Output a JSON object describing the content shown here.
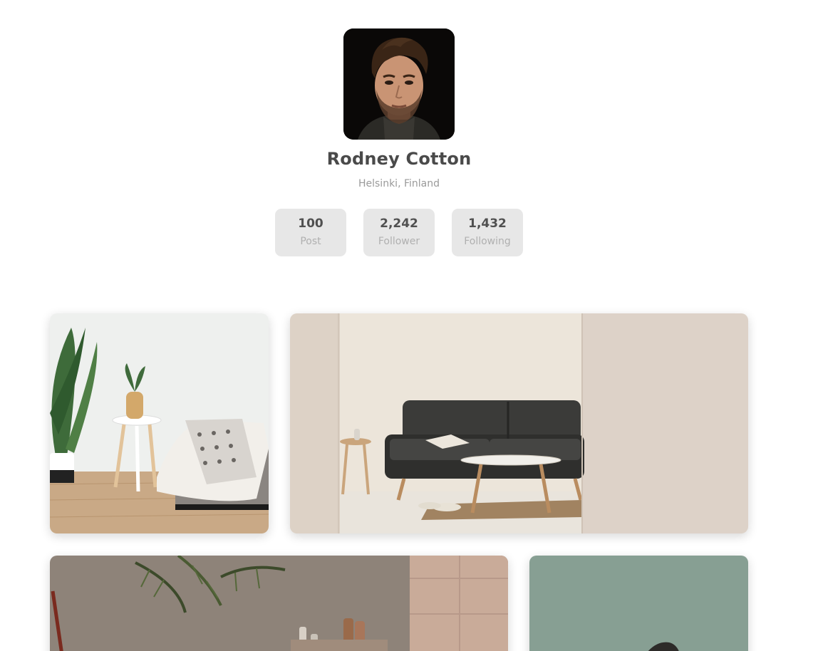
{
  "profile": {
    "name": "Rodney Cotton",
    "location": "Helsinki, Finland",
    "stats": [
      {
        "value": "100",
        "label": "Post"
      },
      {
        "value": "2,242",
        "label": "Follower"
      },
      {
        "value": "1,432",
        "label": "Following"
      }
    ]
  },
  "gallery": {
    "photos": [
      {
        "subject": "bedroom-plant-side-table"
      },
      {
        "subject": "living-room-sofa"
      },
      {
        "subject": "bathroom-palm-wall"
      },
      {
        "subject": "green-wall-chair"
      }
    ]
  },
  "colors": {
    "text_dark": "#4a4a4a",
    "text_muted": "#9a9a9a",
    "stat_bg": "#e7e7e7"
  }
}
